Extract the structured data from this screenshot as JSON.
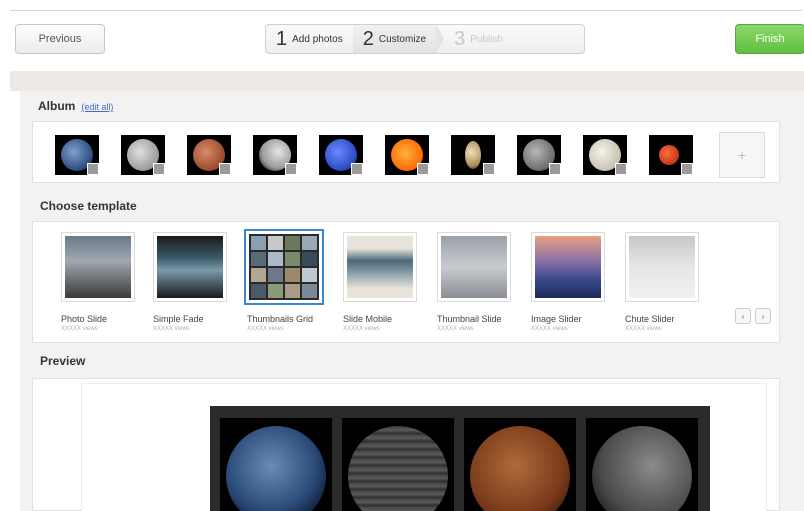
{
  "toolbar": {
    "previous_label": "Previous",
    "finish_label": "Finish",
    "steps": [
      {
        "num": "1",
        "label": "Add photos",
        "state": "done"
      },
      {
        "num": "2",
        "label": "Customize",
        "state": "active"
      },
      {
        "num": "3",
        "label": "Publish",
        "state": "disabled"
      }
    ]
  },
  "album": {
    "title": "Album",
    "edit_label": "(edit all)",
    "add_tile_icon": "+",
    "photos": [
      {
        "icon": "earth-thumbnail",
        "color": "#4a6a9a"
      },
      {
        "icon": "jupiter-thumbnail",
        "color": "#bdbdbd"
      },
      {
        "icon": "mars-thumbnail",
        "color": "#b35a3a"
      },
      {
        "icon": "moon-thumbnail",
        "color": "#cfcfcf"
      },
      {
        "icon": "neptune-thumbnail",
        "color": "#3a5fd0"
      },
      {
        "icon": "sun-thumbnail",
        "color": "#ff7a00"
      },
      {
        "icon": "saturn-thumbnail",
        "color": "#c7b28a"
      },
      {
        "icon": "mercury-thumbnail",
        "color": "#7a7a7a"
      },
      {
        "icon": "venus-thumbnail",
        "color": "#e0dcd0"
      },
      {
        "icon": "red-planet-thumbnail",
        "color": "#c23a1a"
      }
    ]
  },
  "templates": {
    "title": "Choose template",
    "items": [
      {
        "name": "Photo Slide",
        "sub": "XXXXX views"
      },
      {
        "name": "Simple Fade",
        "sub": "XXXXX views"
      },
      {
        "name": "Thumbnails Grid",
        "sub": "XXXXX views",
        "selected": true
      },
      {
        "name": "Slide Mobile",
        "sub": "XXXXX views"
      },
      {
        "name": "Thumbnail Slide",
        "sub": "XXXXX views"
      },
      {
        "name": "Image Slider",
        "sub": "XXXXX views"
      },
      {
        "name": "Chute Slider",
        "sub": "XXXXX views"
      }
    ],
    "prev_icon": "‹",
    "next_icon": "›"
  },
  "preview": {
    "title": "Preview"
  }
}
